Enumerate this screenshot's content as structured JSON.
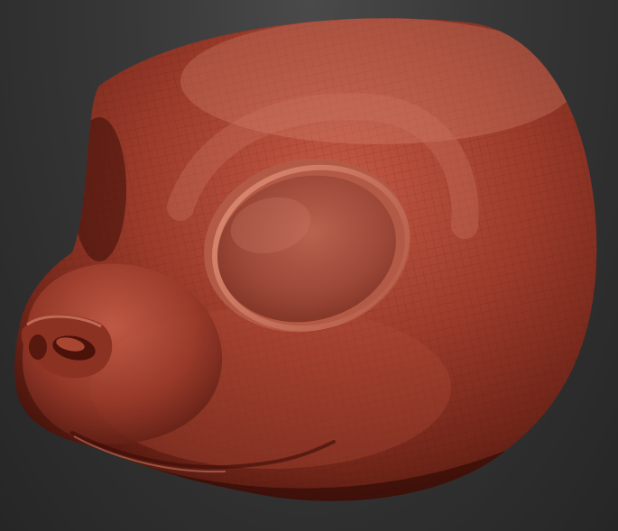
{
  "viewport": {
    "background_top": "#4a4a4a",
    "background_bottom": "#262626"
  },
  "model": {
    "subject": "sculpted-animal-head",
    "material": "red-wax",
    "base_color": "#9c3b2b",
    "highlight_color": "#d9806a",
    "shadow_color": "#3d0f08",
    "wireframe_visible": true,
    "parts": [
      "head",
      "eye-socket",
      "snout",
      "nose",
      "nostril",
      "mouth-line",
      "cheek"
    ]
  }
}
